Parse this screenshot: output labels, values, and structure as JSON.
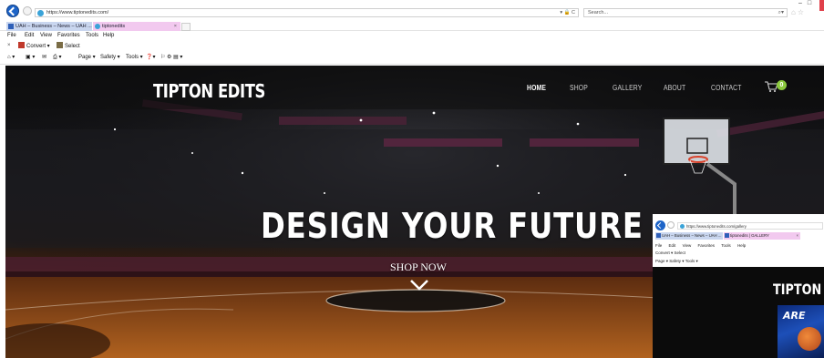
{
  "browser": {
    "url": "https://www.tiptonedits.com/",
    "address_tools": "▾ 🔒 C",
    "search_placeholder": "Search...",
    "tabs": [
      {
        "label": "UAH – Business – News – UAH ..."
      },
      {
        "label": "tiptonedits"
      }
    ],
    "menu": [
      "File",
      "Edit",
      "View",
      "Favorites",
      "Tools",
      "Help"
    ],
    "commands": {
      "convert": "Convert",
      "select": "Select"
    },
    "fav_toolbar": {
      "page": "Page ▾",
      "safety": "Safety ▾",
      "tools": "Tools ▾"
    }
  },
  "site": {
    "logo": "TIPTON EDITS",
    "nav": [
      {
        "label": "HOME",
        "active": true
      },
      {
        "label": "SHOP"
      },
      {
        "label": "GALLERY"
      },
      {
        "label": "ABOUT"
      },
      {
        "label": "CONTACT"
      }
    ],
    "cart_count": "0",
    "hero_headline": "DESIGN YOUR FUTURE",
    "hero_cta": "SHOP NOW"
  },
  "overlay": {
    "url": "https://www.tiptonedits.com/gallery",
    "tabs": [
      {
        "label": "UAH – Business – News – UAH ..."
      },
      {
        "label": "tiptonedits | GALLERY"
      }
    ],
    "menu": [
      "File",
      "Edit",
      "View",
      "Favorites",
      "Tools",
      "Help"
    ],
    "commands": "Convert ▾  Select",
    "fav_toolbar": "Page ▾  Safety ▾  Tools ▾",
    "logo": "TIPTON E",
    "thumb_text": "ARE"
  },
  "colors": {
    "back_button": "#1d64c8",
    "tab_active": "#f2c9ef",
    "tab_inactive": "#c9d6ef",
    "cart_badge": "#8bc93d",
    "court": "#a1541d"
  }
}
